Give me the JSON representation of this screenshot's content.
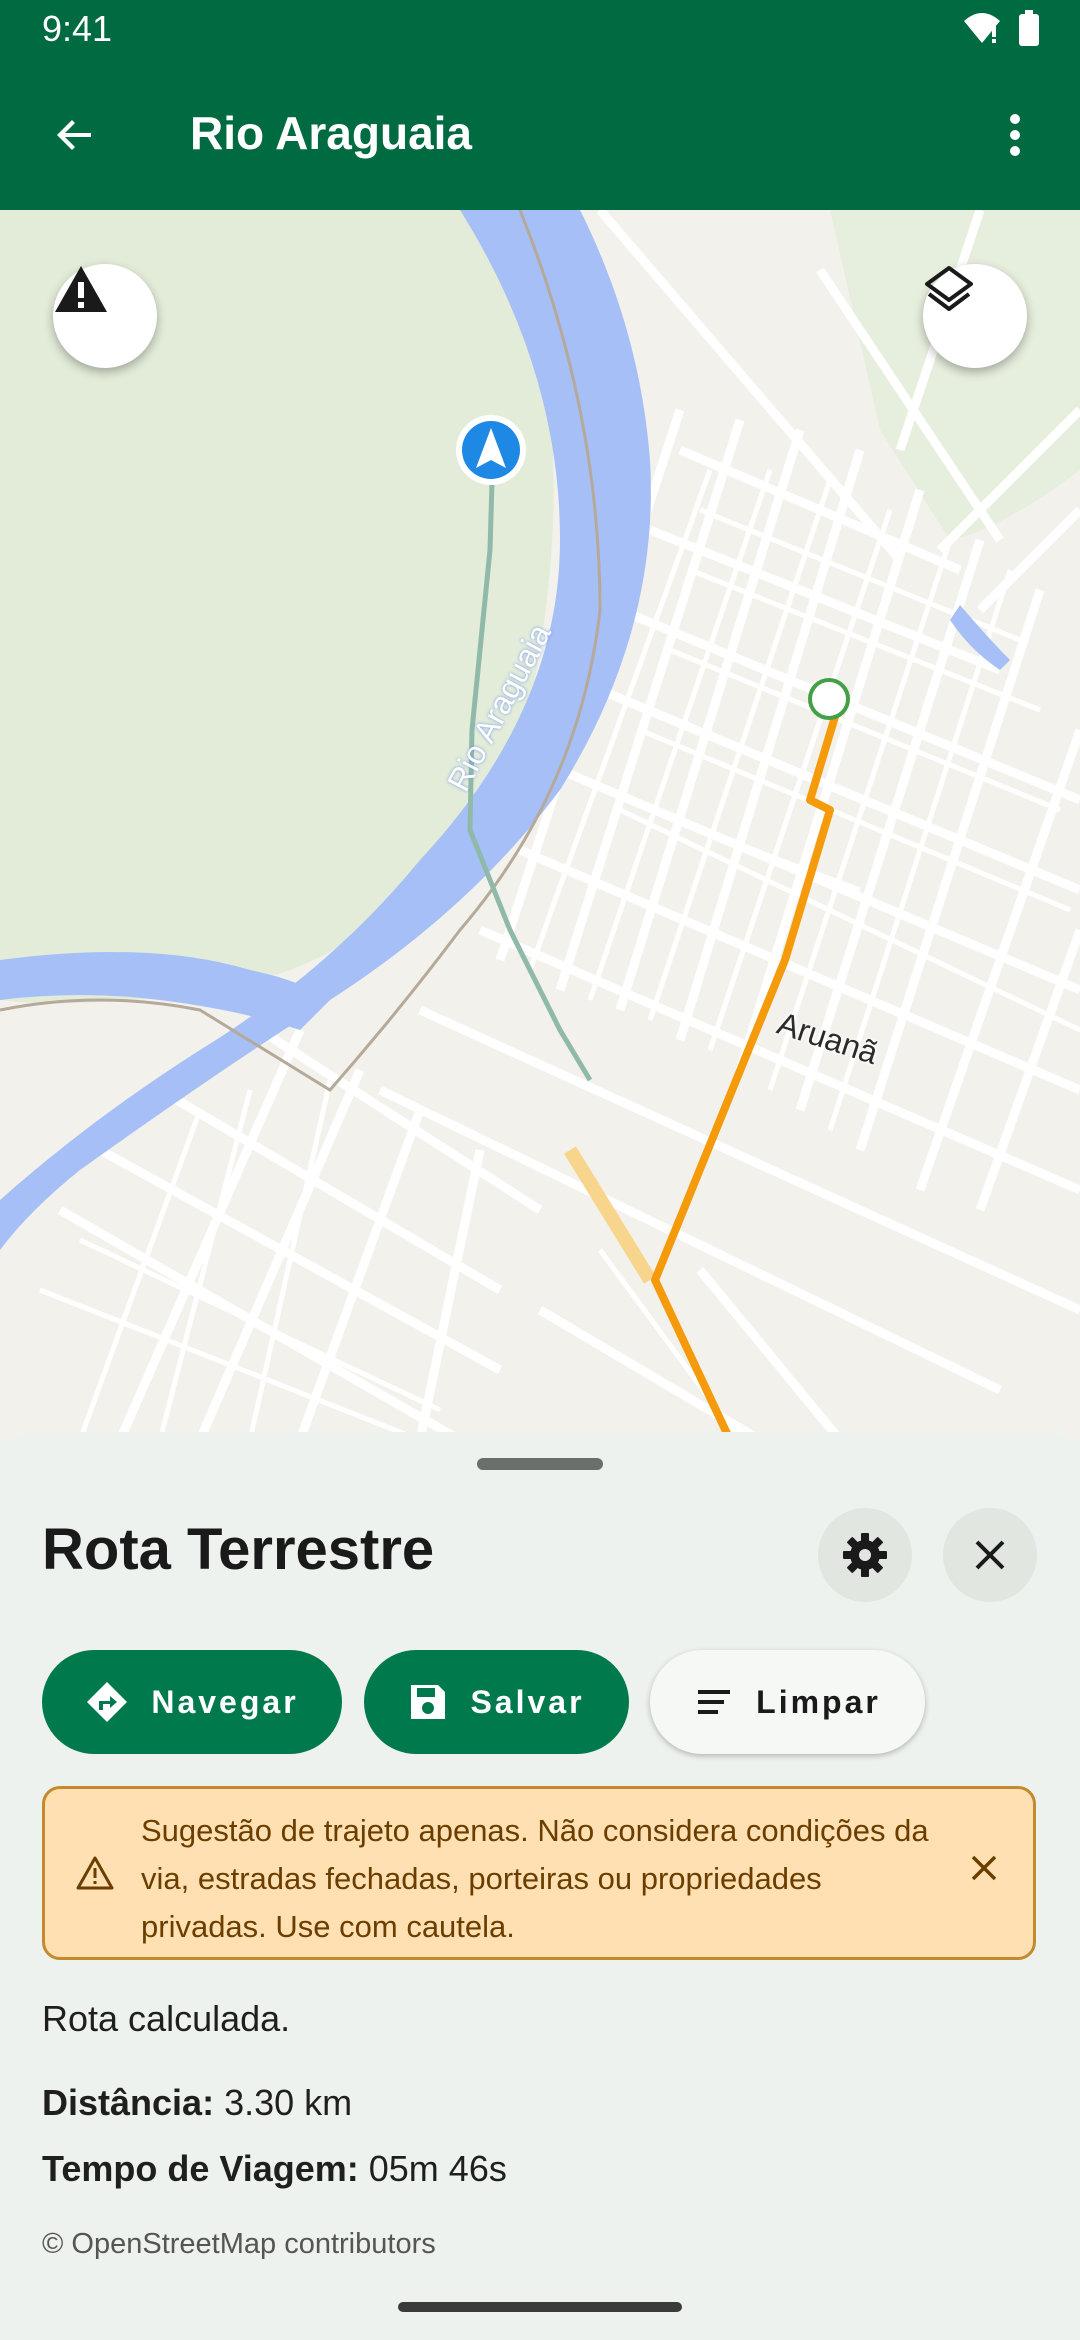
{
  "status_bar": {
    "time": "9:41"
  },
  "app_bar": {
    "title": "Rio Araguaia"
  },
  "map": {
    "labels": {
      "river": "Rio Araguaia",
      "town": "Aruanã"
    },
    "route_color": "#f59a0a",
    "river_color": "#a6bff7",
    "land_color": "#e3ecd9"
  },
  "sheet": {
    "title": "Rota Terrestre",
    "buttons": {
      "navigate": "Navegar",
      "save": "Salvar",
      "clear": "Limpar"
    },
    "alert": "Sugestão de trajeto apenas. Não considera condições da via, estradas fechadas, porteiras ou propriedades privadas. Use com cautela.",
    "status": "Rota calculada.",
    "distance_label": "Distância:",
    "distance_value": "3.30 km",
    "time_label": "Tempo de Viagem:",
    "time_value": "05m 46s",
    "attribution": "© OpenStreetMap contributors"
  }
}
